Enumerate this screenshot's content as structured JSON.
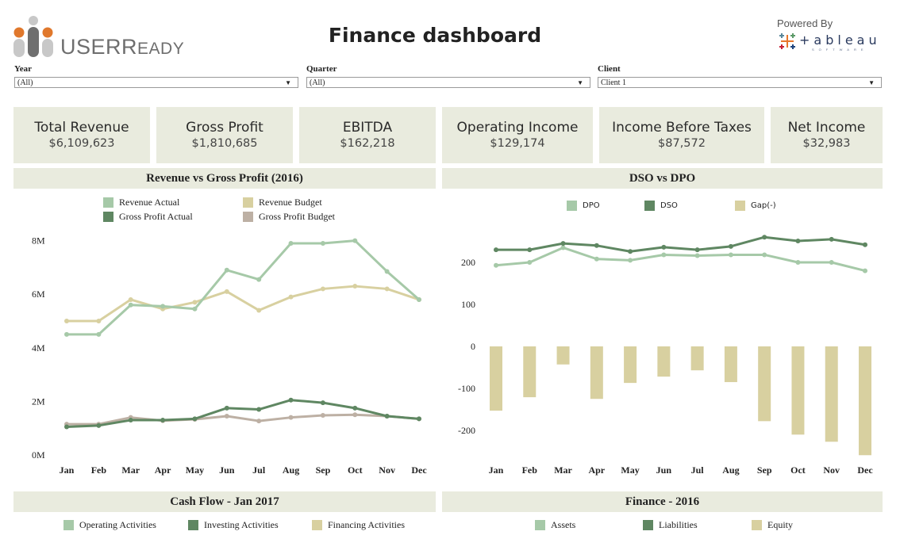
{
  "header": {
    "logo_text_main": "USER",
    "logo_text_small": "EADY",
    "logo_text_cap": "R",
    "title": "Finance dashboard",
    "powered_by": "Powered By",
    "tableau_word": "+ableau",
    "tableau_sub": "SOFTWARE"
  },
  "filters": [
    {
      "label": "Year",
      "value": "(All)"
    },
    {
      "label": "Quarter",
      "value": "(All)"
    },
    {
      "label": "Client",
      "value": "Client 1"
    }
  ],
  "kpis": [
    {
      "label": "Total Revenue",
      "value": "$6,109,623"
    },
    {
      "label": "Gross Profit",
      "value": "$1,810,685"
    },
    {
      "label": "EBITDA",
      "value": "$162,218"
    },
    {
      "label": "Operating Income",
      "value": "$129,174"
    },
    {
      "label": "Income Before Taxes",
      "value": "$87,572"
    },
    {
      "label": "Net Income",
      "value": "$32,983"
    }
  ],
  "colors": {
    "light_green": "#a6c9a8",
    "dark_green": "#5f8762",
    "tan": "#d8d0a0",
    "taupe": "#bdb0a4",
    "panel_bg": "#e9ebde"
  },
  "chart_data": [
    {
      "type": "line",
      "title": "Revenue vs Gross Profit (2016)",
      "xlabel": "",
      "ylabel": "",
      "categories": [
        "Jan",
        "Feb",
        "Mar",
        "Apr",
        "May",
        "Jun",
        "Jul",
        "Aug",
        "Sep",
        "Oct",
        "Nov",
        "Dec"
      ],
      "yticks": [
        "0M",
        "2M",
        "4M",
        "6M",
        "8M"
      ],
      "ylim": [
        0,
        8.5
      ],
      "units": "M",
      "legend": "top",
      "series": [
        {
          "name": "Revenue Actual",
          "color": "#a6c9a8",
          "values": [
            4.5,
            4.5,
            5.6,
            5.55,
            5.45,
            6.9,
            6.55,
            7.9,
            7.9,
            8.0,
            6.85,
            5.8
          ]
        },
        {
          "name": "Revenue Budget",
          "color": "#d8d0a0",
          "values": [
            5.0,
            5.0,
            5.8,
            5.45,
            5.7,
            6.1,
            5.4,
            5.9,
            6.2,
            6.3,
            6.2,
            5.8
          ]
        },
        {
          "name": "Gross Profit Actual",
          "color": "#5f8762",
          "values": [
            1.05,
            1.1,
            1.3,
            1.3,
            1.35,
            1.75,
            1.7,
            2.05,
            1.95,
            1.75,
            1.45,
            1.35
          ]
        },
        {
          "name": "Gross Profit Budget",
          "color": "#bdb0a4",
          "values": [
            1.15,
            1.15,
            1.4,
            1.28,
            1.33,
            1.45,
            1.27,
            1.4,
            1.48,
            1.5,
            1.45,
            1.35
          ]
        }
      ]
    },
    {
      "type": "line",
      "title": "DSO vs DPO",
      "xlabel": "",
      "ylabel": "",
      "categories": [
        "Jan",
        "Feb",
        "Mar",
        "Apr",
        "May",
        "Jun",
        "Jul",
        "Aug",
        "Sep",
        "Oct",
        "Nov",
        "Dec"
      ],
      "yticks": [
        "-200",
        "-100",
        "0",
        "100",
        "200"
      ],
      "ylim": [
        -265,
        270
      ],
      "legend": "top",
      "series": [
        {
          "name": "DPO",
          "kind": "line",
          "color": "#a6c9a8",
          "values": [
            193,
            200,
            235,
            208,
            205,
            218,
            216,
            218,
            218,
            200,
            200,
            180
          ]
        },
        {
          "name": "DSO",
          "kind": "line",
          "color": "#5f8762",
          "values": [
            230,
            230,
            245,
            240,
            226,
            236,
            230,
            238,
            260,
            251,
            255,
            242
          ]
        },
        {
          "name": "Gap(-)",
          "kind": "bar",
          "color": "#d8d0a0",
          "values": [
            -153,
            -121,
            -43,
            -125,
            -87,
            -72,
            -57,
            -85,
            -178,
            -210,
            -227,
            -259
          ]
        }
      ]
    }
  ],
  "sections": {
    "cash_flow": {
      "title": "Cash Flow - Jan 2017",
      "legend": [
        {
          "name": "Operating Activities",
          "color": "#a6c9a8"
        },
        {
          "name": "Investing Activities",
          "color": "#5f8762"
        },
        {
          "name": "Financing Activities",
          "color": "#d8d0a0"
        }
      ]
    },
    "finance": {
      "title": "Finance - 2016",
      "legend": [
        {
          "name": "Assets",
          "color": "#a6c9a8"
        },
        {
          "name": "Liabilities",
          "color": "#5f8762"
        },
        {
          "name": "Equity",
          "color": "#d8d0a0"
        }
      ]
    }
  }
}
